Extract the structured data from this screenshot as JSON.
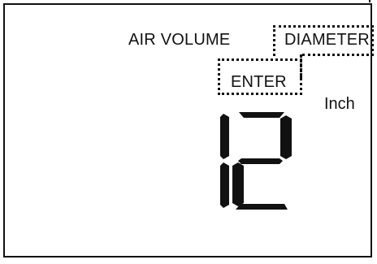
{
  "display": {
    "primary_label": "AIR VOLUME",
    "mode_label": "DIAMETER",
    "action_label": "ENTER",
    "value": "12",
    "unit": "Inch"
  },
  "colors": {
    "segment": "#111111",
    "background": "#ffffff"
  }
}
